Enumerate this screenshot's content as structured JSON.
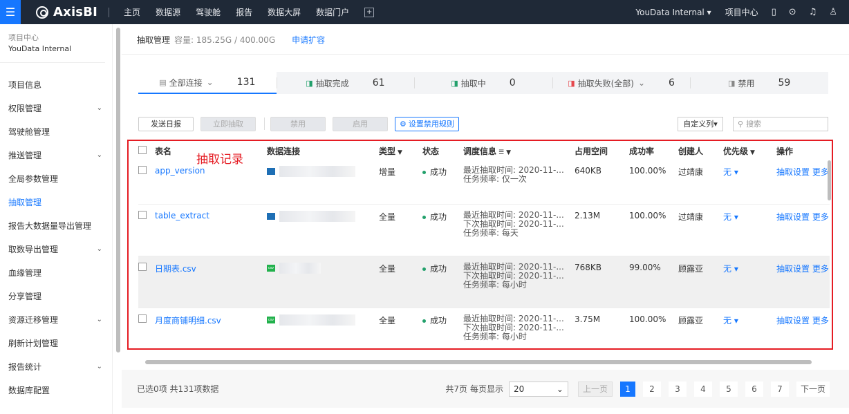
{
  "topbar": {
    "logo": "AxisBI",
    "nav": [
      "主页",
      "数据源",
      "驾驶舱",
      "报告",
      "数据大屏",
      "数据门户"
    ],
    "org": "YouData Internal",
    "project_center": "项目中心"
  },
  "sidebar": {
    "project_label": "项目中心",
    "project_name": "YouData Internal",
    "items": [
      {
        "label": "项目信息",
        "expand": false
      },
      {
        "label": "权限管理",
        "expand": true
      },
      {
        "label": "驾驶舱管理",
        "expand": false
      },
      {
        "label": "推送管理",
        "expand": true
      },
      {
        "label": "全局参数管理",
        "expand": false
      },
      {
        "label": "抽取管理",
        "expand": false,
        "active": true
      },
      {
        "label": "报告大数据量导出管理",
        "expand": false
      },
      {
        "label": "取数导出管理",
        "expand": true
      },
      {
        "label": "血缘管理",
        "expand": false
      },
      {
        "label": "分享管理",
        "expand": false
      },
      {
        "label": "资源迁移管理",
        "expand": true
      },
      {
        "label": "刷新计划管理",
        "expand": false
      },
      {
        "label": "报告统计",
        "expand": true
      },
      {
        "label": "数据库配置",
        "expand": false
      }
    ]
  },
  "header": {
    "title": "抽取管理",
    "capacity": "容量: 185.25G / 400.00G",
    "expand_link": "申请扩容"
  },
  "stats": [
    {
      "label": "全部连接",
      "count": "131"
    },
    {
      "label": "抽取完成",
      "count": "61"
    },
    {
      "label": "抽取中",
      "count": "0"
    },
    {
      "label": "抽取失败(全部)",
      "count": "6"
    },
    {
      "label": "禁用",
      "count": "59"
    }
  ],
  "toolbar": {
    "send_report": "发送日报",
    "extract_now": "立即抽取",
    "disable": "禁用",
    "enable": "启用",
    "set_rule": "设置禁用规则",
    "custom_cols": "自定义列",
    "search_placeholder": "搜索"
  },
  "table": {
    "columns": {
      "name": "表名",
      "conn": "数据连接",
      "type": "类型",
      "status": "状态",
      "sched": "调度信息",
      "space": "占用空间",
      "rate": "成功率",
      "creator": "创建人",
      "prio": "优先级",
      "ops": "操作"
    },
    "rows": [
      {
        "name": "app_version",
        "conn_type": "db",
        "conn_badge": "",
        "conn_text": "",
        "type": "增量",
        "status": "成功",
        "sched": [
          "最近抽取时间: 2020-11-...",
          "任务频率: 仅一次"
        ],
        "space": "640KB",
        "rate": "100.00%",
        "creator": "过靖康",
        "prio": "无",
        "op1": "抽取设置",
        "op2": "更多"
      },
      {
        "name": "table_extract",
        "conn_type": "db",
        "conn_badge": "",
        "conn_text": "",
        "type": "全量",
        "status": "成功",
        "sched": [
          "最近抽取时间: 2020-11-...",
          "下次抽取时间: 2020-11-...",
          "任务频率: 每天"
        ],
        "space": "2.13M",
        "rate": "100.00%",
        "creator": "过靖康",
        "prio": "无",
        "op1": "抽取设置",
        "op2": "更多"
      },
      {
        "name": "日期表.csv",
        "conn_type": "csv",
        "conn_badge": "csv",
        "conn_text": "",
        "type": "全量",
        "status": "成功",
        "sched": [
          "最近抽取时间: 2020-11-...",
          "下次抽取时间: 2020-11-...",
          "任务频率: 每小时"
        ],
        "space": "768KB",
        "rate": "99.00%",
        "creator": "顾露亚",
        "prio": "无",
        "op1": "抽取设置",
        "op2": "更多"
      },
      {
        "name": "月度商铺明细.csv",
        "conn_type": "csv",
        "conn_badge": "csv",
        "conn_text": "",
        "type": "全量",
        "status": "成功",
        "sched": [
          "最近抽取时间: 2020-11-...",
          "下次抽取时间: 2020-11-...",
          "任务频率: 每小时"
        ],
        "space": "3.75M",
        "rate": "100.00%",
        "creator": "顾露亚",
        "prio": "无",
        "op1": "抽取设置",
        "op2": "更多"
      }
    ]
  },
  "annotation": {
    "label": "抽取记录"
  },
  "footer": {
    "selected": "已选0项 共131项数据",
    "total_pages": "共7页",
    "per_page_label": "每页显示",
    "per_page": "20",
    "prev": "上一页",
    "pages": [
      "1",
      "2",
      "3",
      "4",
      "5",
      "6",
      "7"
    ],
    "next": "下一页"
  },
  "colors": {
    "accent": "#1677ff",
    "annotation": "#e51c23",
    "success": "#22a06b"
  }
}
